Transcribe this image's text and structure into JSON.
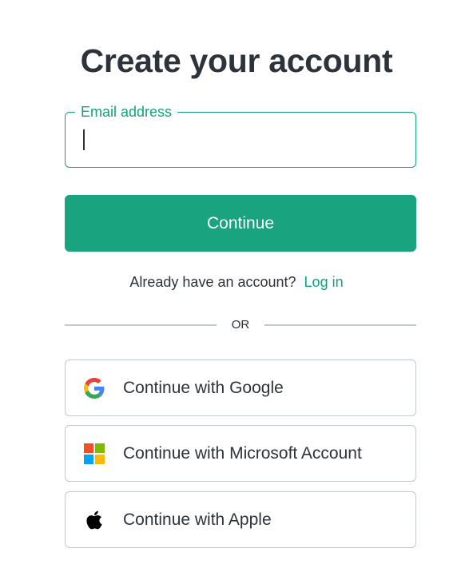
{
  "title": "Create your account",
  "email": {
    "label": "Email address",
    "value": ""
  },
  "continue_label": "Continue",
  "login": {
    "prompt": "Already have an account?",
    "link": "Log in"
  },
  "divider_text": "OR",
  "social": [
    {
      "label": "Continue with Google",
      "icon": "google-icon"
    },
    {
      "label": "Continue with Microsoft Account",
      "icon": "microsoft-icon"
    },
    {
      "label": "Continue with Apple",
      "icon": "apple-icon"
    }
  ],
  "colors": {
    "accent": "#10a37f",
    "button": "#19a37e",
    "text": "#2d333a",
    "border": "#c2c8d0"
  }
}
